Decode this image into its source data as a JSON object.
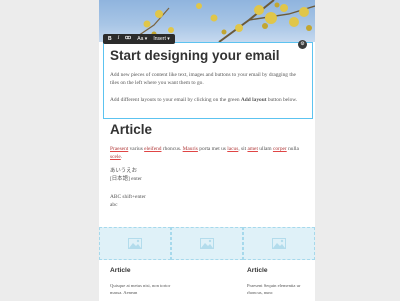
{
  "toolbar": {
    "bold": "B",
    "italic": "I",
    "link_icon": "link-icon",
    "font_size": "Aa",
    "insert": "Insert",
    "dropdown_icon": "chevron-down-icon"
  },
  "block_handle": {
    "icon": "gear-icon",
    "glyph": "⚙"
  },
  "intro": {
    "title": "Start designing your email",
    "para1": "Add new pieces of content like text, images and buttons to your email by dragging the tiles on the left where you want them to go.",
    "para2_pre": "Add different layouts to your email by clicking on the green ",
    "para2_bold": "Add layout",
    "para2_post": " button below."
  },
  "article": {
    "title": "Article",
    "words": [
      "Praesent",
      " varius ",
      "eleifend",
      " rhoncus. ",
      "Mauris",
      " porta met us ",
      "lacus",
      ", sit ",
      "amet",
      " ullam ",
      "corper",
      " nulla ",
      "scele",
      "."
    ],
    "jp_line1": "あいうえお",
    "jp_line2": "[日本語]     enter",
    "abc_line1": "ABC     shift+enter",
    "abc_line2": "abc"
  },
  "image_placeholders": [
    "image-placeholder-icon",
    "image-placeholder-icon",
    "image-placeholder-icon"
  ],
  "columns": [
    {
      "title": "Article",
      "text": "Quisque at metus nisi, non tortor massa. Aenean"
    },
    {
      "title": "Article",
      "text": "Praesent Sequin elementia ur rhoncus, nunc"
    }
  ],
  "colors": {
    "selection": "#5cc3f0",
    "toolbar_bg": "#2b2b2b",
    "spell_underline": "#e04545",
    "placeholder_bg": "#dff1f8"
  }
}
